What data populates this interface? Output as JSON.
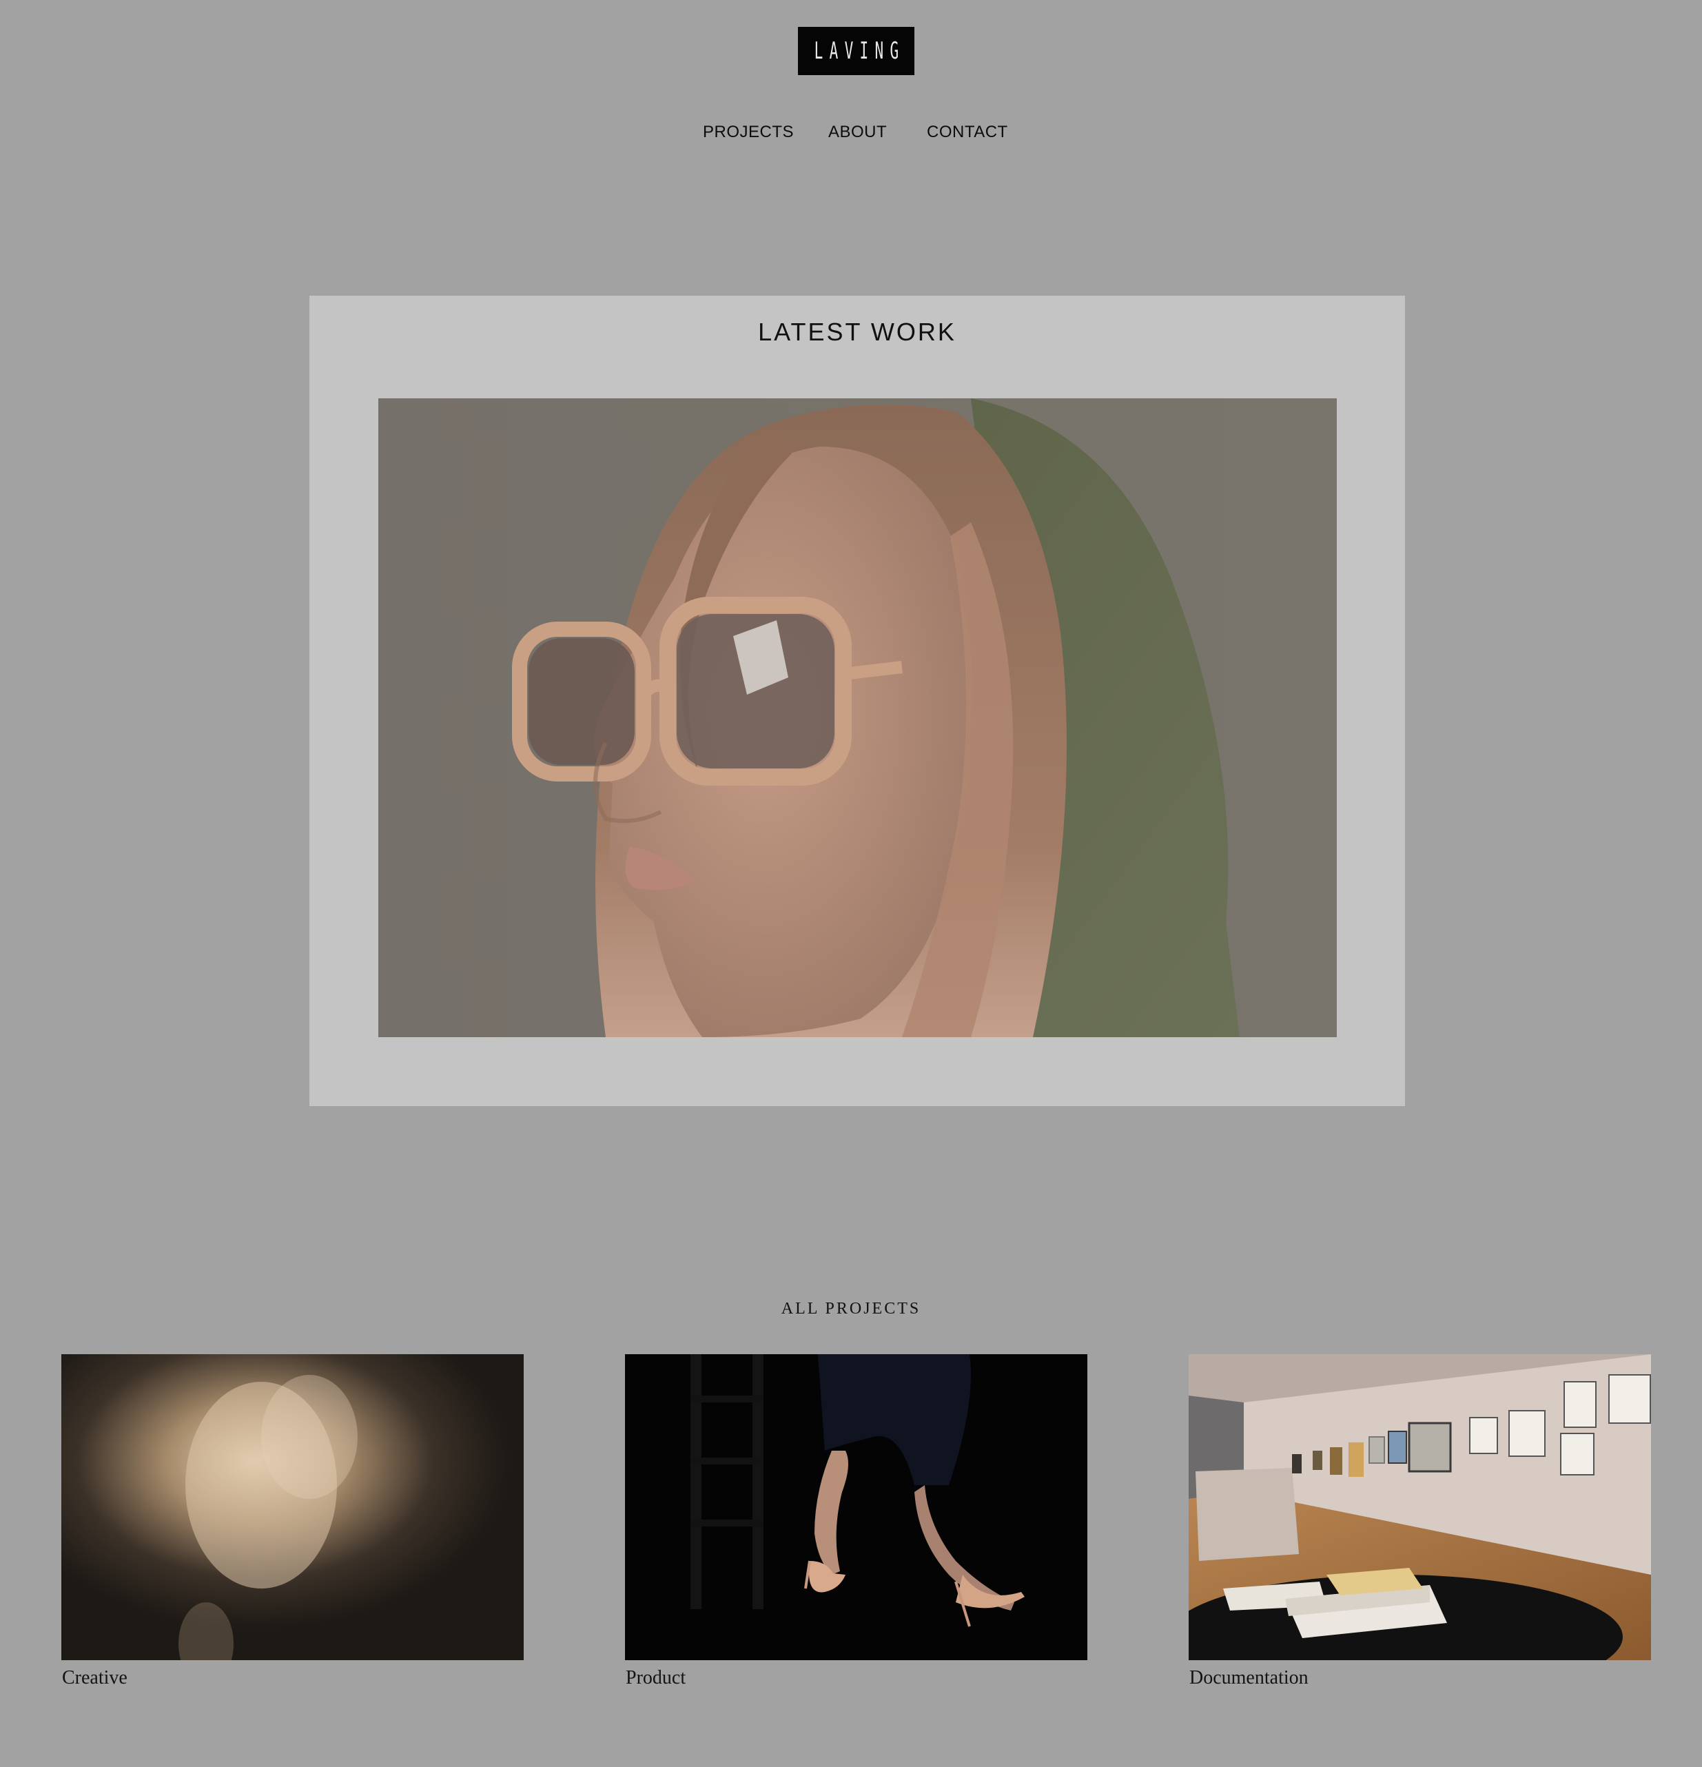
{
  "header": {
    "logo_text": "LAVING"
  },
  "nav": {
    "items": [
      {
        "label": "PROJECTS"
      },
      {
        "label": "ABOUT"
      },
      {
        "label": "CONTACT"
      }
    ]
  },
  "latest": {
    "title": "LATEST WORK",
    "image": "portrait-woman-sunglasses-green-headscarf"
  },
  "projects": {
    "title": "ALL PROJECTS",
    "items": [
      {
        "label": "Creative",
        "image": "blurred-figure-white-shirt"
      },
      {
        "label": "Product",
        "image": "legs-nude-stiletto-heels"
      },
      {
        "label": "Documentation",
        "image": "gallery-interior-framed-artworks"
      }
    ]
  },
  "colors": {
    "page_background": "#a2a2a2",
    "panel_background": "#c4c4c4",
    "logo_background": "#050505",
    "text": "#111111"
  }
}
